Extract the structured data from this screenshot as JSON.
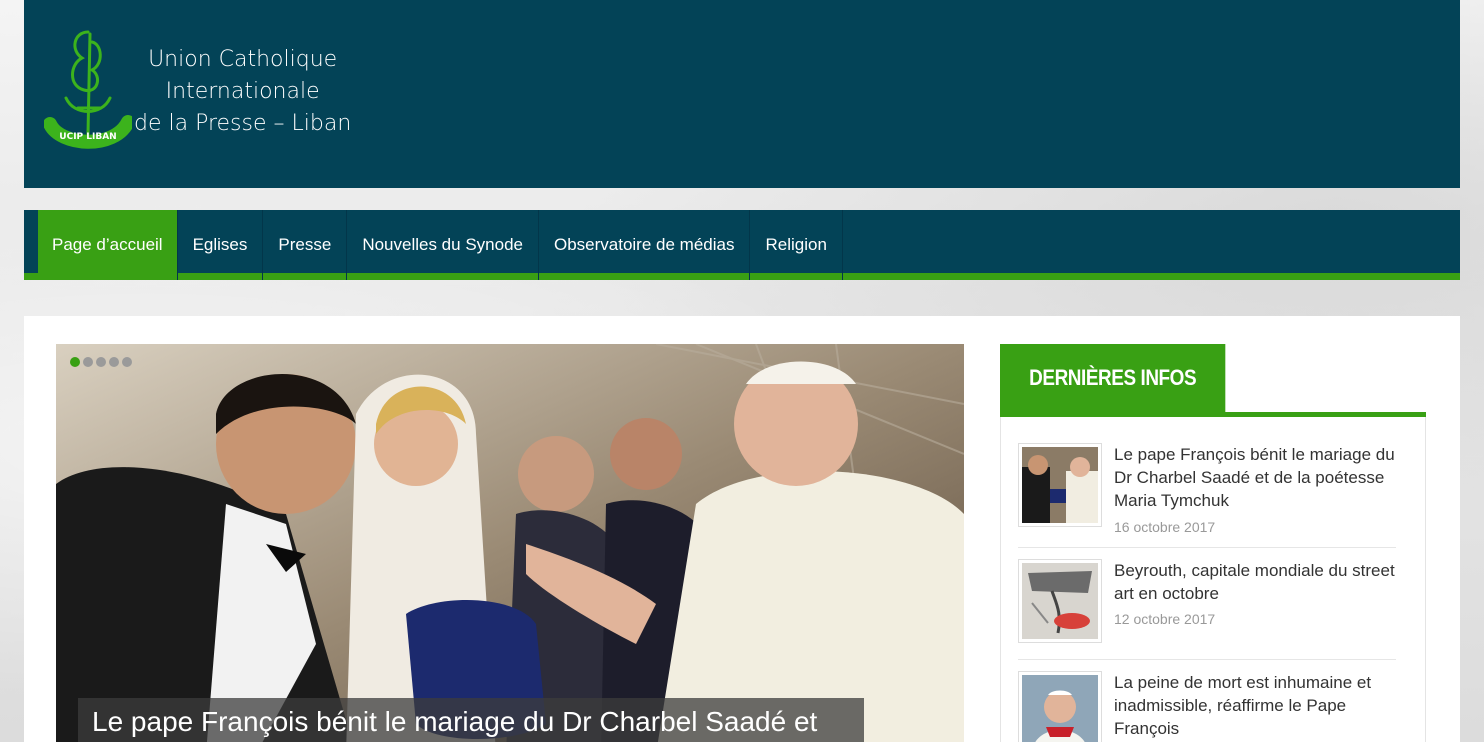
{
  "header": {
    "logo_icon": "ucip-liban-logo",
    "logo_lettering": "UCIP LIBAN",
    "org_name_line1": "Union Catholique",
    "org_name_line2": "Internationale",
    "org_name_line3": "de la Presse – Liban"
  },
  "nav": {
    "items": [
      {
        "label": "Page d’accueil",
        "active": true
      },
      {
        "label": "Eglises"
      },
      {
        "label": "Presse"
      },
      {
        "label": "Nouvelles du Synode"
      },
      {
        "label": "Observatoire de médias"
      },
      {
        "label": "Religion"
      }
    ]
  },
  "slider": {
    "active_index": 0,
    "dots": 5,
    "caption": "Le pape François bénit le mariage du Dr Charbel Saadé et"
  },
  "sidebar": {
    "widget_title": "DERNIÈRES INFOS",
    "news": [
      {
        "title": "Le pape François bénit le mariage du Dr Charbel Saadé et de la poétesse Maria Tymchuk",
        "date": "16 octobre 2017"
      },
      {
        "title": "Beyrouth, capitale mondiale du street art en octobre",
        "date": "12 octobre 2017"
      },
      {
        "title": "La peine de mort est inhumaine et inadmissible, réaffirme le Pape François",
        "date": ""
      }
    ]
  },
  "colors": {
    "primary": "#034357",
    "accent": "#39a014"
  }
}
